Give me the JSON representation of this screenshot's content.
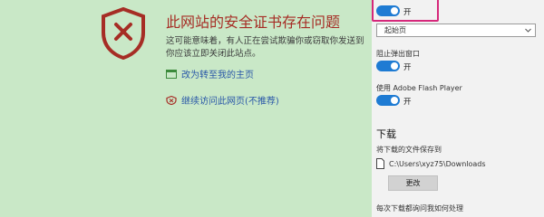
{
  "error_page": {
    "title": "此网站的安全证书存在问题",
    "description_lines": [
      "这可能意味着，有人正在尝试欺骗你或窃取你发送到",
      "你应该立即关闭此站点。"
    ],
    "link_home": "改为转至我的主页",
    "link_continue": "继续访问此网页(不推荐)",
    "colors": {
      "background": "#c9e8c7",
      "title": "#a62d25",
      "link": "#2a58a8"
    }
  },
  "settings_panel": {
    "top_toggle_state": "开",
    "startup_select_value": "起始页",
    "popup_label": "阻止弹出窗口",
    "popup_state": "开",
    "flash_label": "使用 Adobe Flash Player",
    "flash_state": "开",
    "downloads_heading": "下载",
    "save_location_label": "将下载的文件保存到",
    "download_path": "C:\\Users\\xyz75\\Downloads",
    "change_button": "更改",
    "ask_label": "每次下载都询问我如何处理",
    "colors": {
      "toggle_on": "#1e7bd3",
      "highlight": "#d6287b"
    }
  }
}
